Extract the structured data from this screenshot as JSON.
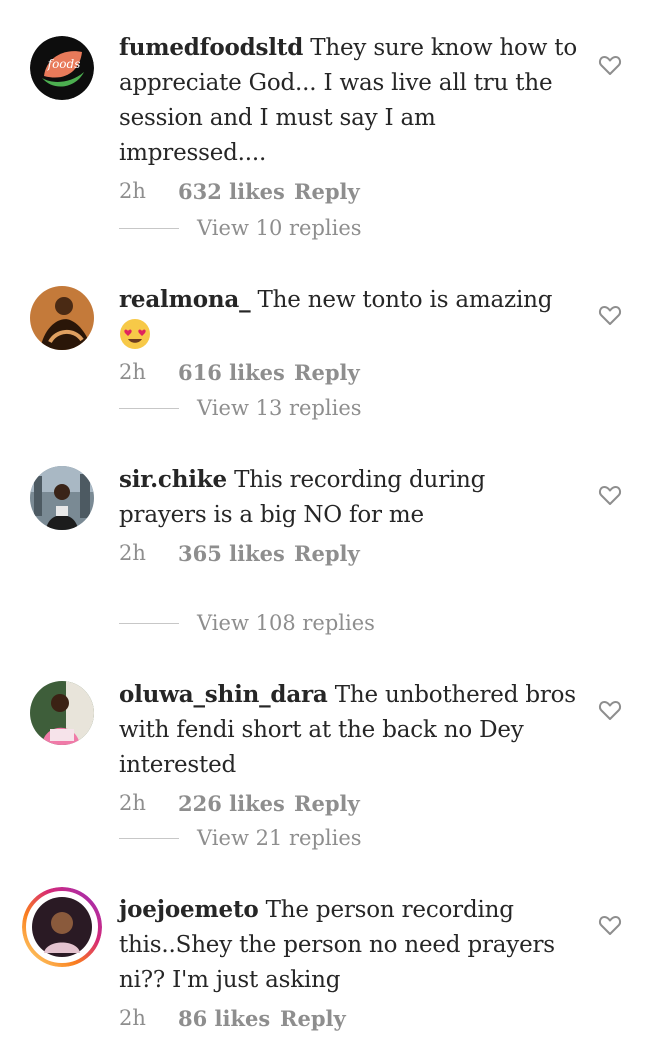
{
  "comments": [
    {
      "username": "fumedfoodsltd",
      "text": "They sure know how to appreciate God... I was live all tru the session and I must say I am impressed....",
      "time": "2h",
      "likes": "632 likes",
      "reply": "Reply",
      "view_replies": "View 10 replies",
      "avatar_icon": "fumed-foods-logo"
    },
    {
      "username": "realmona_",
      "text": "The new tonto is amazing",
      "emoji": "heart-eyes-emoji",
      "time": "2h",
      "likes": "616 likes",
      "reply": "Reply",
      "view_replies": "View 13 replies",
      "avatar_icon": "user-avatar"
    },
    {
      "username": "sir.chike",
      "text": "This recording during prayers is a big NO for me",
      "time": "2h",
      "likes": "365 likes",
      "reply": "Reply",
      "view_replies": "View 108 replies",
      "avatar_icon": "user-avatar"
    },
    {
      "username": "oluwa_shin_dara",
      "text": "The unbothered bros with fendi short at the back no Dey interested",
      "time": "2h",
      "likes": "226 likes",
      "reply": "Reply",
      "view_replies": "View 21 replies",
      "avatar_icon": "user-avatar"
    },
    {
      "username": "joejoemeto",
      "text": "The person recording this..Shey the person no need prayers ni?? I'm just asking",
      "time": "2h",
      "likes": "86 likes",
      "reply": "Reply",
      "avatar_icon": "story-ring-avatar"
    }
  ],
  "colors": {
    "text": "#262626",
    "muted": "#8e8e8e",
    "divider": "#c7c7c7",
    "brand_green": "#6ab04c"
  }
}
